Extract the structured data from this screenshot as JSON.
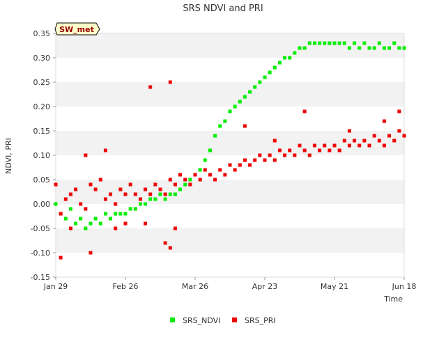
{
  "chart_data": {
    "type": "scatter",
    "title": "SRS NDVI and PRI",
    "xlabel": "Time",
    "ylabel": "NDVI, PRI",
    "site_badge": "SW_met",
    "ylim": [
      -0.15,
      0.35
    ],
    "yticks": [
      -0.15,
      -0.1,
      -0.05,
      0.0,
      0.05,
      0.1,
      0.15,
      0.2,
      0.25,
      0.3,
      0.35
    ],
    "ytick_labels": [
      "-0.15",
      "-0.10",
      "-0.05",
      "0.00",
      "0.05",
      "0.10",
      "0.15",
      "0.20",
      "0.25",
      "0.30",
      "0.35"
    ],
    "xlim": [
      "Jan 29",
      "Jun 18"
    ],
    "xticks": [
      "Jan 29",
      "Feb 26",
      "Mar 26",
      "Apr 23",
      "May 21",
      "Jun 18"
    ],
    "grid": "horizontal bands",
    "legend_position": "bottom-center",
    "series": [
      {
        "name": "SRS_NDVI",
        "color": "#00ee00",
        "points": [
          [
            "Jan 29",
            0.0
          ],
          [
            "Jan 31",
            -0.02
          ],
          [
            "Feb 2",
            -0.03
          ],
          [
            "Feb 4",
            -0.01
          ],
          [
            "Feb 6",
            -0.04
          ],
          [
            "Feb 8",
            -0.03
          ],
          [
            "Feb 10",
            -0.05
          ],
          [
            "Feb 12",
            -0.04
          ],
          [
            "Feb 14",
            -0.03
          ],
          [
            "Feb 16",
            -0.04
          ],
          [
            "Feb 18",
            -0.02
          ],
          [
            "Feb 20",
            -0.03
          ],
          [
            "Feb 22",
            -0.02
          ],
          [
            "Feb 24",
            -0.02
          ],
          [
            "Feb 26",
            -0.02
          ],
          [
            "Feb 28",
            -0.01
          ],
          [
            "Mar 2",
            -0.01
          ],
          [
            "Mar 4",
            0.0
          ],
          [
            "Mar 6",
            0.0
          ],
          [
            "Mar 8",
            0.01
          ],
          [
            "Mar 10",
            0.01
          ],
          [
            "Mar 12",
            0.02
          ],
          [
            "Mar 14",
            0.01
          ],
          [
            "Mar 16",
            0.02
          ],
          [
            "Mar 18",
            0.02
          ],
          [
            "Mar 20",
            0.03
          ],
          [
            "Mar 22",
            0.04
          ],
          [
            "Mar 24",
            0.05
          ],
          [
            "Mar 26",
            0.06
          ],
          [
            "Mar 28",
            0.07
          ],
          [
            "Mar 30",
            0.09
          ],
          [
            "Apr 1",
            0.11
          ],
          [
            "Apr 3",
            0.14
          ],
          [
            "Apr 5",
            0.16
          ],
          [
            "Apr 7",
            0.17
          ],
          [
            "Apr 9",
            0.19
          ],
          [
            "Apr 11",
            0.2
          ],
          [
            "Apr 13",
            0.21
          ],
          [
            "Apr 15",
            0.22
          ],
          [
            "Apr 17",
            0.23
          ],
          [
            "Apr 19",
            0.24
          ],
          [
            "Apr 21",
            0.25
          ],
          [
            "Apr 23",
            0.26
          ],
          [
            "Apr 25",
            0.27
          ],
          [
            "Apr 27",
            0.28
          ],
          [
            "Apr 29",
            0.29
          ],
          [
            "May 1",
            0.3
          ],
          [
            "May 3",
            0.3
          ],
          [
            "May 5",
            0.31
          ],
          [
            "May 7",
            0.32
          ],
          [
            "May 9",
            0.32
          ],
          [
            "May 11",
            0.33
          ],
          [
            "May 13",
            0.33
          ],
          [
            "May 15",
            0.33
          ],
          [
            "May 17",
            0.33
          ],
          [
            "May 19",
            0.33
          ],
          [
            "May 21",
            0.33
          ],
          [
            "May 23",
            0.33
          ],
          [
            "May 25",
            0.33
          ],
          [
            "May 27",
            0.32
          ],
          [
            "May 29",
            0.33
          ],
          [
            "May 31",
            0.32
          ],
          [
            "Jun 2",
            0.33
          ],
          [
            "Jun 4",
            0.32
          ],
          [
            "Jun 6",
            0.32
          ],
          [
            "Jun 8",
            0.33
          ],
          [
            "Jun 10",
            0.32
          ],
          [
            "Jun 12",
            0.32
          ],
          [
            "Jun 14",
            0.33
          ],
          [
            "Jun 16",
            0.32
          ],
          [
            "Jun 18",
            0.32
          ]
        ]
      },
      {
        "name": "SRS_PRI",
        "color": "#ee0000",
        "points": [
          [
            "Jan 29",
            0.04
          ],
          [
            "Jan 31",
            -0.02
          ],
          [
            "Feb 2",
            0.01
          ],
          [
            "Feb 4",
            0.02
          ],
          [
            "Feb 6",
            0.03
          ],
          [
            "Feb 8",
            0.0
          ],
          [
            "Feb 10",
            -0.01
          ],
          [
            "Feb 12",
            0.04
          ],
          [
            "Feb 14",
            0.03
          ],
          [
            "Feb 16",
            0.05
          ],
          [
            "Feb 18",
            0.01
          ],
          [
            "Feb 20",
            0.02
          ],
          [
            "Feb 22",
            0.0
          ],
          [
            "Feb 24",
            0.03
          ],
          [
            "Feb 26",
            0.02
          ],
          [
            "Feb 28",
            0.04
          ],
          [
            "Mar 2",
            0.02
          ],
          [
            "Mar 4",
            0.01
          ],
          [
            "Mar 6",
            0.03
          ],
          [
            "Mar 8",
            0.02
          ],
          [
            "Mar 10",
            0.04
          ],
          [
            "Mar 12",
            0.03
          ],
          [
            "Mar 14",
            0.02
          ],
          [
            "Mar 16",
            0.05
          ],
          [
            "Mar 18",
            0.04
          ],
          [
            "Mar 20",
            0.06
          ],
          [
            "Mar 22",
            0.05
          ],
          [
            "Mar 24",
            0.04
          ],
          [
            "Mar 26",
            0.06
          ],
          [
            "Mar 28",
            0.05
          ],
          [
            "Mar 30",
            0.07
          ],
          [
            "Apr 1",
            0.06
          ],
          [
            "Apr 3",
            0.05
          ],
          [
            "Apr 5",
            0.07
          ],
          [
            "Apr 7",
            0.06
          ],
          [
            "Apr 9",
            0.08
          ],
          [
            "Apr 11",
            0.07
          ],
          [
            "Apr 13",
            0.08
          ],
          [
            "Apr 15",
            0.09
          ],
          [
            "Apr 17",
            0.08
          ],
          [
            "Apr 19",
            0.09
          ],
          [
            "Apr 21",
            0.1
          ],
          [
            "Apr 23",
            0.09
          ],
          [
            "Apr 25",
            0.1
          ],
          [
            "Apr 27",
            0.09
          ],
          [
            "Apr 29",
            0.11
          ],
          [
            "May 1",
            0.1
          ],
          [
            "May 3",
            0.11
          ],
          [
            "May 5",
            0.1
          ],
          [
            "May 7",
            0.12
          ],
          [
            "May 9",
            0.11
          ],
          [
            "May 11",
            0.1
          ],
          [
            "May 13",
            0.12
          ],
          [
            "May 15",
            0.11
          ],
          [
            "May 17",
            0.12
          ],
          [
            "May 19",
            0.11
          ],
          [
            "May 21",
            0.12
          ],
          [
            "May 23",
            0.11
          ],
          [
            "May 25",
            0.13
          ],
          [
            "May 27",
            0.12
          ],
          [
            "May 29",
            0.13
          ],
          [
            "May 31",
            0.12
          ],
          [
            "Jun 2",
            0.13
          ],
          [
            "Jun 4",
            0.12
          ],
          [
            "Jun 6",
            0.14
          ],
          [
            "Jun 8",
            0.13
          ],
          [
            "Jun 10",
            0.12
          ],
          [
            "Jun 12",
            0.14
          ],
          [
            "Jun 14",
            0.13
          ],
          [
            "Jun 16",
            0.15
          ],
          [
            "Jun 18",
            0.14
          ],
          [
            "Feb 4",
            -0.05
          ],
          [
            "Feb 12",
            -0.1
          ],
          [
            "Feb 22",
            -0.05
          ],
          [
            "Mar 6",
            -0.04
          ],
          [
            "Mar 14",
            -0.08
          ],
          [
            "Mar 16",
            -0.09
          ],
          [
            "Mar 8",
            0.24
          ],
          [
            "Mar 16",
            0.25
          ],
          [
            "Mar 18",
            -0.05
          ],
          [
            "Apr 15",
            0.16
          ],
          [
            "May 9",
            0.19
          ],
          [
            "Jun 16",
            0.19
          ],
          [
            "Feb 10",
            0.1
          ],
          [
            "Feb 18",
            0.11
          ],
          [
            "Feb 26",
            -0.04
          ],
          [
            "Jan 31",
            -0.11
          ],
          [
            "Jun 10",
            0.17
          ],
          [
            "May 27",
            0.15
          ],
          [
            "Apr 27",
            0.13
          ]
        ]
      }
    ]
  }
}
